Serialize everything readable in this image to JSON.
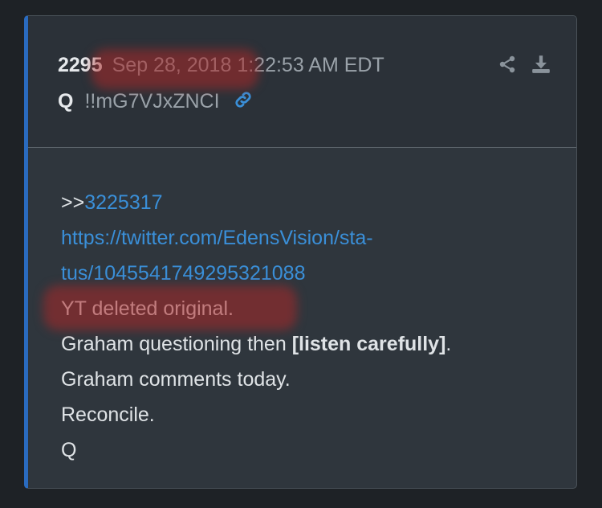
{
  "post": {
    "number": "2295",
    "timestamp": "Sep 28, 2018 1:22:53 AM EDT",
    "author": "Q",
    "tripcode": "!!mG7VJxZNCI"
  },
  "icons": {
    "share": "share-icon",
    "download": "download-icon",
    "permalink": "link-icon"
  },
  "message": {
    "reply_prefix": ">>",
    "reply_ref": "3225317",
    "url_line1": "https://twitter.com/EdensVision/sta-",
    "url_line2": "tus/1045541749295321088",
    "line_yt": "YT deleted original.",
    "line_graham_pre": "Graham questioning then ",
    "line_graham_bold": "[listen carefully]",
    "line_graham_post": ".",
    "line_comments": "Graham comments today.",
    "line_reconcile": "Reconcile.",
    "signature": "Q"
  },
  "colors": {
    "accent_border": "#2a6bbf",
    "link": "#3a8fd8",
    "redaction": "#aa2828"
  }
}
